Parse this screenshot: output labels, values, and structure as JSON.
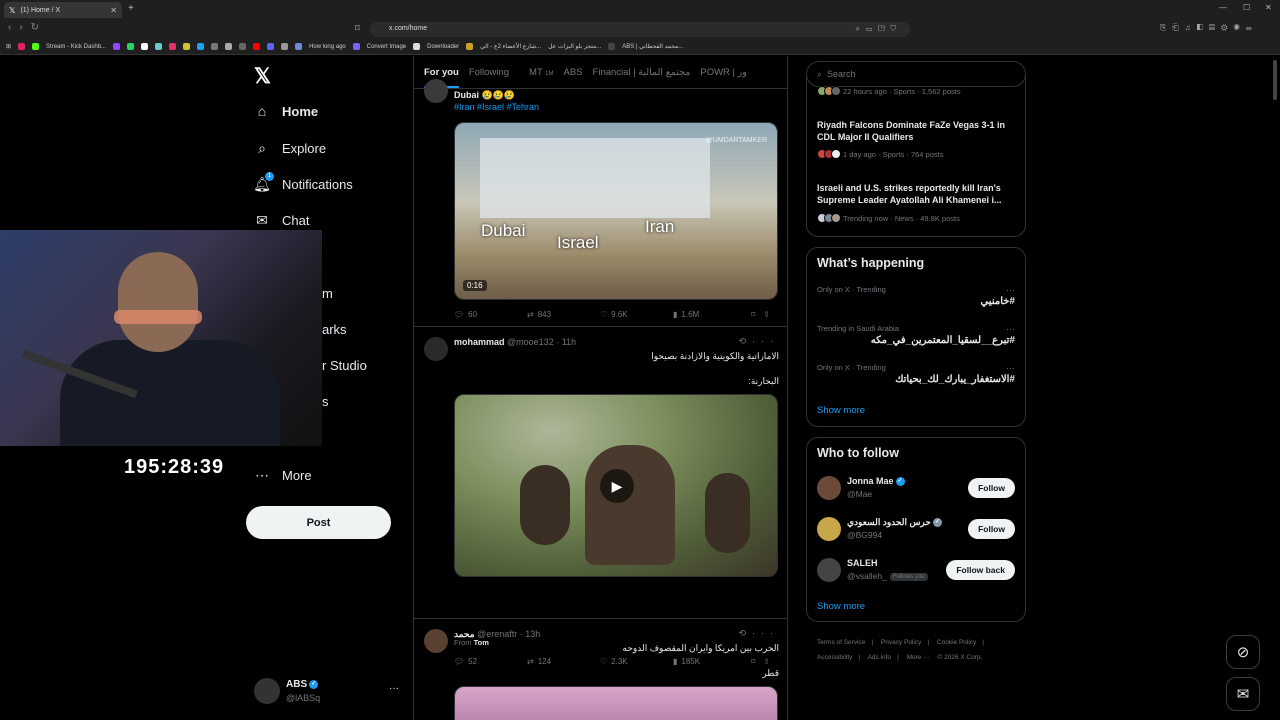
{
  "browser": {
    "tab_title": "(1) Home / X",
    "url": "x.com/home",
    "bookmarks": [
      "Stream - Kick Dashb...",
      "How long ago",
      "Convert Image",
      "Downloader",
      "شارع الأعضاء 2ع - الي...",
      "متجر بلو البزات عل...",
      "ABS | محمد القحطاني..."
    ]
  },
  "nav": {
    "items": [
      {
        "label": "Home",
        "icon": "home-icon"
      },
      {
        "label": "Explore",
        "icon": "search-icon"
      },
      {
        "label": "Notifications",
        "icon": "bell-icon",
        "badge": "1"
      },
      {
        "label": "Chat",
        "icon": "mail-icon"
      },
      {
        "label": "m"
      },
      {
        "label": "arks"
      },
      {
        "label": "r Studio"
      },
      {
        "label": "s"
      },
      {
        "label": "More",
        "icon": "more-icon"
      }
    ],
    "post_label": "Post",
    "profile": {
      "name": "ABS",
      "handle": "@lABSq"
    }
  },
  "stream": {
    "timer": "195:28:39"
  },
  "tabs": [
    "For you",
    "Following",
    "MT",
    "ABS",
    "Financial | مجتمع المالية",
    "POWR | ور"
  ],
  "tabs_mt_sub": "1M",
  "posts": [
    {
      "text": "Dubai 😢😢😢",
      "hashtags": "#Iran #Israel #Tehran",
      "media_labels": [
        "Dubai",
        "Israel",
        "Iran"
      ],
      "watermark": "@UMDARTAMKER",
      "duration": "0:16",
      "replies": "60",
      "reposts": "843",
      "likes": "9.6K",
      "views": "1.6M"
    },
    {
      "author": "mohammad",
      "handle": "@mooe132 · 11h",
      "line1": "الاماراتية والكويتية والازادنة بصيحوا",
      "line2": "البحارنة:",
      "from_label": "From",
      "from_name": "Tom",
      "replies": "52",
      "reposts": "124",
      "likes": "2.3K",
      "views": "185K"
    },
    {
      "author": "محمد",
      "handle": "@erenaftr · 13h",
      "line1": "الحرب بين امريكا وايران المقصوف الدوحه",
      "line2": "قطر"
    }
  ],
  "search": {
    "placeholder": "Search"
  },
  "trends": [
    {
      "meta": "22 hours ago · Sports · 1,562 posts"
    },
    {
      "title": "Riyadh Falcons Dominate FaZe Vegas 3-1 in CDL Major II Qualifiers",
      "meta": "1 day ago · Sports · 764 posts"
    },
    {
      "title": "Israeli and U.S. strikes reportedly kill Iran's Supreme Leader Ayatollah Ali Khamenei i...",
      "meta": "Trending now · News · 49.8K posts"
    }
  ],
  "happening": {
    "title": "What’s happening",
    "items": [
      {
        "context": "Only on X · Trending",
        "tag": "#خامنيي"
      },
      {
        "context": "Trending in Saudi Arabia",
        "tag": "#تبرع__لسقيا_المعتمرين_في_مكه"
      },
      {
        "context": "Only on X · Trending",
        "tag": "#الاستغفار_يبارك_لك_بحياتك"
      }
    ],
    "show_more": "Show more"
  },
  "who_to_follow": {
    "title": "Who to follow",
    "items": [
      {
        "name": "Jonna Mae",
        "handle": "@Mae",
        "button": "Follow",
        "avatar_color": "#6b4a3a"
      },
      {
        "name": "حرس الحدود السعودي",
        "handle": "@BG994",
        "button": "Follow",
        "avatar_color": "#c8a64a"
      },
      {
        "name": "SALEH",
        "handle": "@vsalleh_",
        "button": "Follow back",
        "follows_you": "Follows you",
        "avatar_color": "#444"
      }
    ],
    "show_more": "Show more"
  },
  "footer": [
    "Terms of Service",
    "|",
    "Privacy Policy",
    "|",
    "Cookie Policy",
    "|",
    "Accessibility",
    "|",
    "Ads info",
    "|",
    "More ···",
    "© 2026 X Corp."
  ],
  "colors": {
    "accent": "#1d9bf0",
    "bg": "#000000",
    "border": "#2f3336"
  }
}
